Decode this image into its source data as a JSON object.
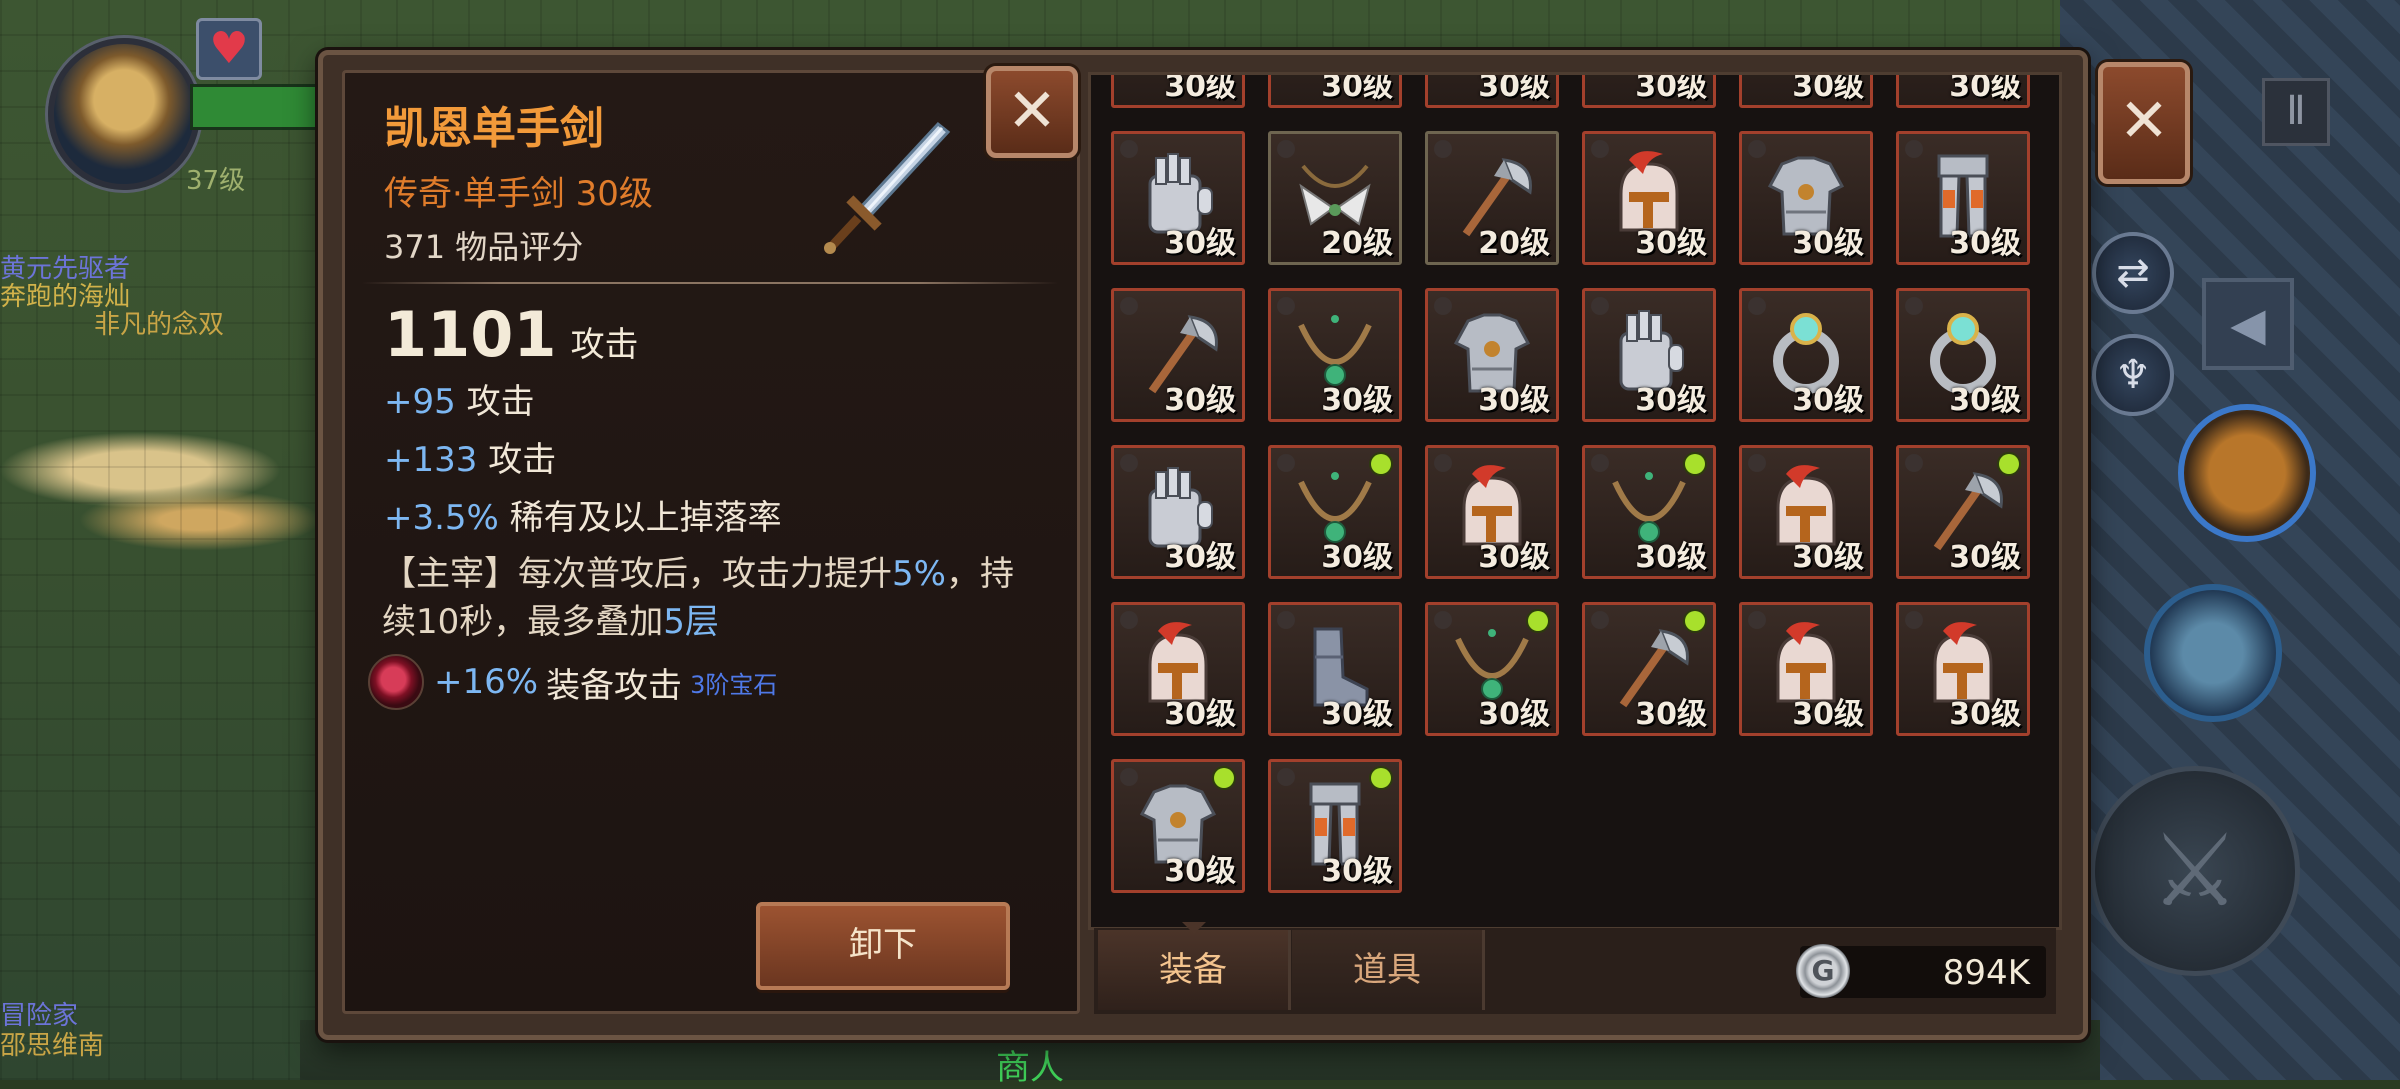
{
  "world": {
    "level_text": "37级",
    "names": [
      "黄元先驱者",
      "奔跑的海灿",
      "非凡的念双",
      "冒险家",
      "邵思维南",
      "商人"
    ]
  },
  "item_detail": {
    "name": "凯恩单手剑",
    "subtitle": "传奇·单手剑 30级",
    "score": "371 物品评分",
    "attack_value": "1101",
    "attack_label": "攻击",
    "stats": [
      {
        "value": "+95",
        "label": "攻击"
      },
      {
        "value": "+133",
        "label": "攻击"
      },
      {
        "value": "+3.5%",
        "label": "稀有及以上掉落率"
      }
    ],
    "skill": {
      "prefix": "【主宰】每次普攻后，攻击力提升",
      "pct": "5%",
      "mid": "，持续10秒，最多叠加",
      "stacks": "5层"
    },
    "gem": {
      "value": "+16%",
      "label": "装备攻击",
      "tier": "3阶宝石"
    },
    "unequip_label": "卸下"
  },
  "inventory": {
    "partial_row_levels": [
      "30级",
      "30级",
      "30级",
      "30级",
      "30级",
      "30级"
    ],
    "slots": [
      {
        "icon": "gauntlet-icon",
        "level": "30级",
        "new": false,
        "border": "red"
      },
      {
        "icon": "wings-necklace-icon",
        "level": "20级",
        "new": false,
        "border": "green"
      },
      {
        "icon": "axe-icon",
        "level": "20级",
        "new": false,
        "border": "green"
      },
      {
        "icon": "helmet-icon",
        "level": "30级",
        "new": false,
        "border": "red"
      },
      {
        "icon": "chest-armor-icon",
        "level": "30级",
        "new": false,
        "border": "red"
      },
      {
        "icon": "leg-armor-icon",
        "level": "30级",
        "new": false,
        "border": "red"
      },
      {
        "icon": "axe-icon",
        "level": "30级",
        "new": false,
        "border": "red"
      },
      {
        "icon": "necklace-icon",
        "level": "30级",
        "new": false,
        "border": "red"
      },
      {
        "icon": "chest-armor-icon",
        "level": "30级",
        "new": false,
        "border": "red"
      },
      {
        "icon": "gauntlet-icon",
        "level": "30级",
        "new": false,
        "border": "red"
      },
      {
        "icon": "ring-icon",
        "level": "30级",
        "new": false,
        "border": "red"
      },
      {
        "icon": "ring-icon",
        "level": "30级",
        "new": false,
        "border": "red"
      },
      {
        "icon": "gauntlet-icon",
        "level": "30级",
        "new": false,
        "border": "red"
      },
      {
        "icon": "necklace-icon",
        "level": "30级",
        "new": true,
        "border": "red"
      },
      {
        "icon": "helmet-icon",
        "level": "30级",
        "new": false,
        "border": "red"
      },
      {
        "icon": "necklace-icon",
        "level": "30级",
        "new": true,
        "border": "red"
      },
      {
        "icon": "helmet-icon",
        "level": "30级",
        "new": false,
        "border": "red"
      },
      {
        "icon": "axe-icon",
        "level": "30级",
        "new": true,
        "border": "red"
      },
      {
        "icon": "helmet-icon",
        "level": "30级",
        "new": false,
        "border": "red"
      },
      {
        "icon": "boots-icon",
        "level": "30级",
        "new": false,
        "border": "red"
      },
      {
        "icon": "necklace-icon",
        "level": "30级",
        "new": true,
        "border": "red"
      },
      {
        "icon": "axe-icon",
        "level": "30级",
        "new": true,
        "border": "red"
      },
      {
        "icon": "helmet-icon",
        "level": "30级",
        "new": false,
        "border": "red"
      },
      {
        "icon": "helmet-icon",
        "level": "30级",
        "new": false,
        "border": "red"
      },
      {
        "icon": "chest-armor-icon",
        "level": "30级",
        "new": true,
        "border": "red"
      },
      {
        "icon": "leg-armor-icon",
        "level": "30级",
        "new": true,
        "border": "red"
      }
    ]
  },
  "tabs": {
    "equip": "装备",
    "items": "道具"
  },
  "currency": {
    "icon": "silver-coin-icon",
    "value": "894K"
  },
  "colors": {
    "legendary": "#f29a3a",
    "stat_blue": "#7db7f2",
    "slot_border_red": "#a3402c",
    "new_dot": "#a8e02c"
  }
}
